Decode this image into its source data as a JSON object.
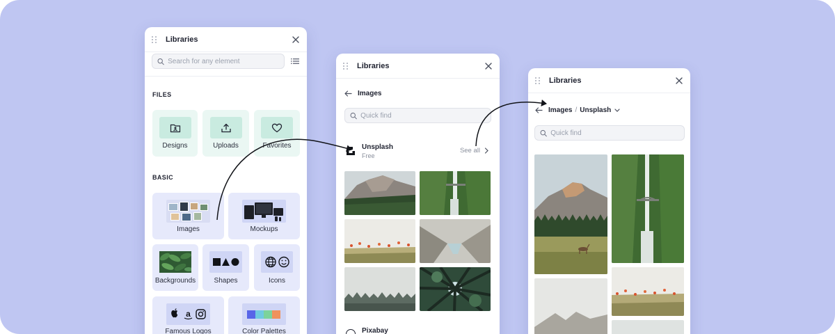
{
  "colors": {
    "background": "#bfc6f2",
    "files_tile": "#eaf7f3",
    "basic_tile": "#e6e9fb"
  },
  "panel1": {
    "title": "Libraries",
    "search_placeholder": "Search for any element",
    "files_label": "FILES",
    "files": [
      {
        "label": "Designs",
        "icon": "folder-user-icon"
      },
      {
        "label": "Uploads",
        "icon": "upload-icon"
      },
      {
        "label": "Favorites",
        "icon": "heart-icon"
      }
    ],
    "basic_label": "BASIC",
    "basic": [
      {
        "label": "Images"
      },
      {
        "label": "Mockups"
      },
      {
        "label": "Backgrounds"
      },
      {
        "label": "Shapes"
      },
      {
        "label": "Icons"
      },
      {
        "label": "Famous Logos"
      },
      {
        "label": "Color Palettes"
      }
    ]
  },
  "panel2": {
    "title": "Libraries",
    "back_label": "Images",
    "search_placeholder": "Quick find",
    "provider1": {
      "name": "Unsplash",
      "price": "Free",
      "see_all": "See all"
    },
    "provider2": {
      "name": "Pixabay"
    }
  },
  "panel3": {
    "title": "Libraries",
    "crumb_parent": "Images",
    "crumb_sep": "/",
    "crumb_current": "Unsplash",
    "search_placeholder": "Quick find"
  }
}
